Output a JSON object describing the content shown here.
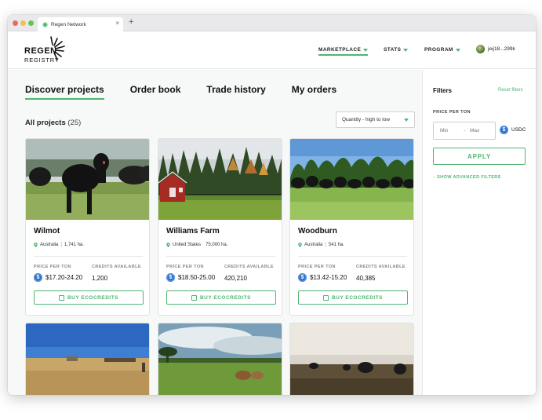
{
  "browser": {
    "tab_title": "Regen Network",
    "close_glyph": "×",
    "new_tab_glyph": "+"
  },
  "header": {
    "logo_top": "REGEN",
    "logo_bottom": "REGISTRY",
    "nav": [
      {
        "label": "MARKETPLACE"
      },
      {
        "label": "STATS"
      },
      {
        "label": "PROGRAM"
      }
    ],
    "account": "jeij18...299k"
  },
  "main": {
    "tabs": [
      {
        "label": "Discover projects"
      },
      {
        "label": "Order book"
      },
      {
        "label": "Trade history"
      },
      {
        "label": "My orders"
      }
    ],
    "all_projects_label": "All projects",
    "all_projects_count": "(25)",
    "sort_label": "Quantity - high to low"
  },
  "card_labels": {
    "price_per_ton": "PRICE PER TON",
    "credits_available": "CREDITS AVAILABLE",
    "buy": "BUY ECOCREDITS",
    "coin": "$"
  },
  "projects": [
    {
      "name": "Wilmot",
      "country": "Australia",
      "area": "1,741 ha.",
      "price": "$17.20-24.20",
      "credits": "1,200"
    },
    {
      "name": "Williams Farm",
      "country": "United States",
      "area": "75,000 ha.",
      "price": "$18.50-25.00",
      "credits": "420,210"
    },
    {
      "name": "Woodburn",
      "country": "Australia",
      "area": "541 ha.",
      "price": "$13.42-15.20",
      "credits": "40,385"
    }
  ],
  "filters": {
    "title": "Filters",
    "reset": "Reset filters",
    "price_per_ton": "PRICE PER TON",
    "min_placeholder": "Min",
    "dash": "-",
    "max_placeholder": "Max",
    "currency": "USDC",
    "apply": "APPLY",
    "advanced": "↓ SHOW ADVANCED FILTERS"
  },
  "colors": {
    "accent": "#4fb573",
    "coin": "#2a70c8"
  }
}
